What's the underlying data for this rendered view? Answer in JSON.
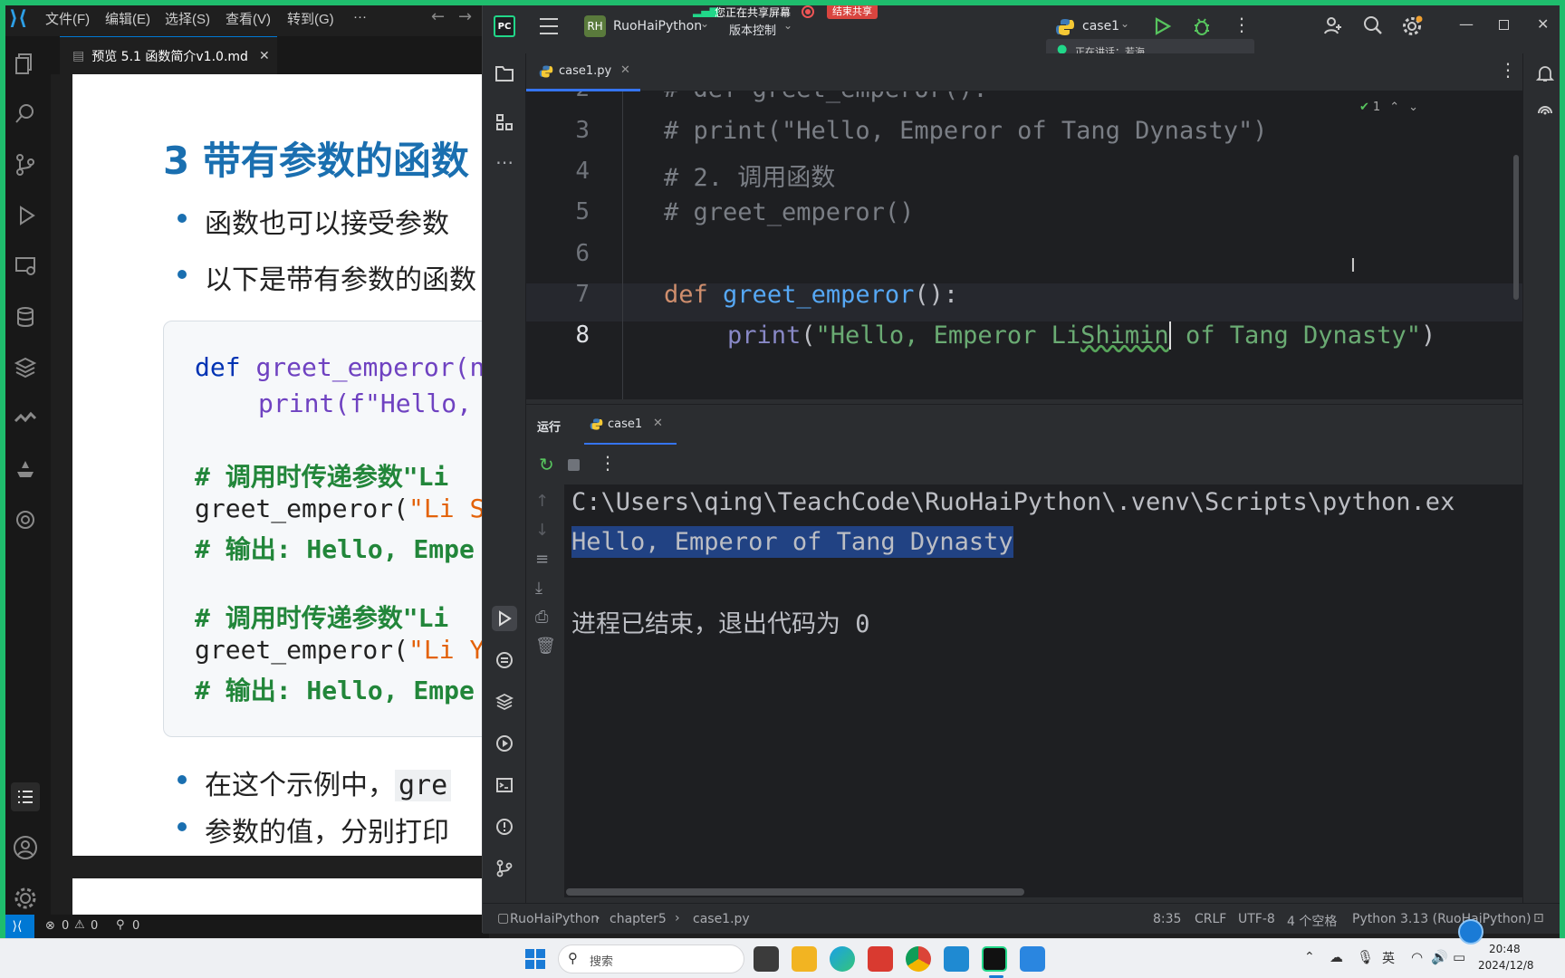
{
  "vscode": {
    "menu": [
      "文件(F)",
      "编辑(E)",
      "选择(S)",
      "查看(V)",
      "转到(G)",
      "···"
    ],
    "tab_title": "预览 5.1 函数简介v1.0.md",
    "preview": {
      "heading": "3 带有参数的函数",
      "bullet1": "函数也可以接受参数",
      "bullet2": "以下是带有参数的函数",
      "code": {
        "l1_kw": "def",
        "l1_fn": "greet_emperor(n",
        "l2": "print(f\"Hello,",
        "l4": "# 调用时传递参数\"Li",
        "l5_fn": "greet_emperor(",
        "l5_str": "\"Li S",
        "l6": "# 输出: Hello, Empe",
        "l8": "# 调用时传递参数\"Li",
        "l9_fn": "greet_emperor(",
        "l9_str": "\"Li Y",
        "l10": "# 输出: Hello, Empe"
      },
      "bullet3_a": "在这个示例中，",
      "bullet3_code": "gre",
      "bullet3_b": "参数的值，分别打印"
    },
    "status": {
      "errors": "0",
      "warnings": "0",
      "ports": "0"
    }
  },
  "pycharm": {
    "project_badge": "RH",
    "project_name": "RuoHaiPython",
    "vcs_label": "版本控制",
    "sharing_text": "您正在共享屏幕",
    "stop_share": "结束共享",
    "run_config": "case1",
    "voice_text": "正在讲话：若海",
    "editor_tab": "case1.py",
    "inspection_count": "1",
    "lines": [
      {
        "n": "2",
        "text": "# def greet_emperor():"
      },
      {
        "n": "3",
        "text": "#     print(\"Hello, Emperor of Tang Dynasty\")"
      },
      {
        "n": "4",
        "text": "# 2. 调用函数"
      },
      {
        "n": "5",
        "text": "# greet_emperor()"
      },
      {
        "n": "6",
        "text": ""
      },
      {
        "n": "7",
        "kw": "def",
        "fn": "greet_emperor",
        "rest": "():"
      },
      {
        "n": "8",
        "print": "print",
        "open": "(",
        "str_a": "\"Hello, Emperor Li",
        "str_err": "Shimin",
        "str_b": " of Tang Dynasty\"",
        "close": ")"
      }
    ],
    "run_label": "运行",
    "run_tab": "case1",
    "console": {
      "cmd": "C:\\Users\\qing\\TeachCode\\RuoHaiPython\\.venv\\Scripts\\python.ex",
      "output": "Hello, Emperor of Tang Dynasty",
      "exit": "进程已结束，退出代码为 0"
    },
    "breadcrumb": [
      "RuoHaiPython",
      "chapter5",
      "case1.py"
    ],
    "status": {
      "position": "8:35",
      "line_sep": "CRLF",
      "encoding": "UTF-8",
      "indent": "4 个空格",
      "interpreter": "Python 3.13 (RuoHaiPython)"
    }
  },
  "taskbar": {
    "search_placeholder": "搜索",
    "ime": "英",
    "time": "20:48",
    "date": "2024/12/8"
  },
  "colors": {
    "share_border": "#1fbd6d",
    "keyword": "#cf8e6d",
    "function": "#56a8f5",
    "string": "#6aab73",
    "comment": "#7a7e85",
    "selection": "#214283",
    "vscode_accent": "#0078d4"
  }
}
